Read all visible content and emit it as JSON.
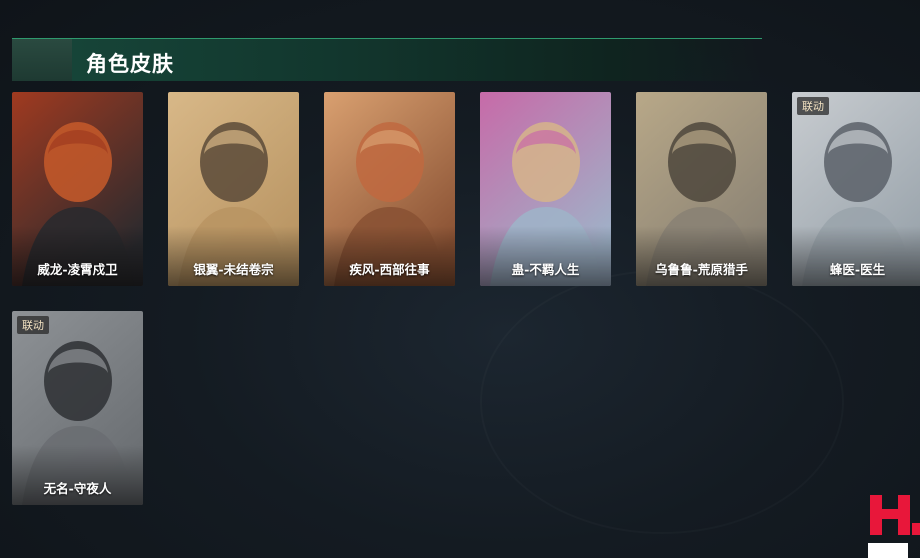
{
  "section": {
    "title": "角色皮肤"
  },
  "skins": [
    {
      "name": "威龙-凌霄戍卫",
      "tag": "",
      "palette": [
        "#2a2a2e",
        "#c75a2a",
        "#a03a20"
      ]
    },
    {
      "name": "银翼-未结卷宗",
      "tag": "",
      "palette": [
        "#b99563",
        "#5a4a38",
        "#d8b888"
      ]
    },
    {
      "name": "疾风-西部往事",
      "tag": "",
      "palette": [
        "#8a5234",
        "#c0693f",
        "#d9a070"
      ]
    },
    {
      "name": "蛊-不羁人生",
      "tag": "",
      "palette": [
        "#9fb2c8",
        "#d6b48a",
        "#c76aa8"
      ]
    },
    {
      "name": "乌鲁鲁-荒原猎手",
      "tag": "",
      "palette": [
        "#8a8274",
        "#4e473c",
        "#b8a888"
      ]
    },
    {
      "name": "蜂医-医生",
      "tag": "联动",
      "palette": [
        "#9aa4ac",
        "#5a6068",
        "#c8ccd0"
      ]
    },
    {
      "name": "无名-守夜人",
      "tag": "联动",
      "palette": [
        "#6a6e72",
        "#2e3034",
        "#8e9296"
      ]
    }
  ],
  "colors": {
    "header_accent": "#2f9a6e",
    "logo_red": "#e8173a"
  }
}
